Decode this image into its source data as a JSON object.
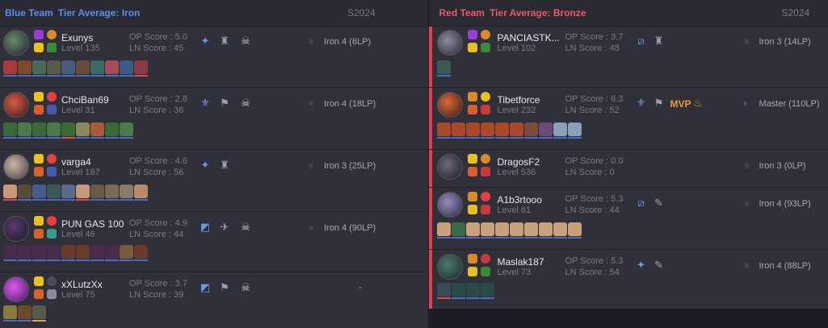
{
  "blue": {
    "team_name": "Blue Team",
    "tier_label": "Tier Average: Iron",
    "season": "S2024",
    "players": [
      {
        "name": "Exunys",
        "level": "Level 135",
        "op": "OP Score : 5.0",
        "ln": "LN Score : 45",
        "rank": "Iron 4 (6LP)"
      },
      {
        "name": "ChciBan69",
        "level": "Level 31",
        "op": "OP Score : 2.8",
        "ln": "LN Score : 36",
        "rank": "Iron 4 (18LP)"
      },
      {
        "name": "varga4",
        "level": "Level 187",
        "op": "OP Score : 4.6",
        "ln": "LN Score : 56",
        "rank": "Iron 3 (25LP)"
      },
      {
        "name": "PUN GAS 100",
        "level": "Level 46",
        "op": "OP Score : 4.9",
        "ln": "LN Score : 44",
        "rank": "Iron 4 (90LP)"
      },
      {
        "name": "xXLutzXx",
        "level": "Level 75",
        "op": "OP Score : 3.7",
        "ln": "LN Score : 39",
        "rank": "-"
      }
    ]
  },
  "red": {
    "team_name": "Red Team",
    "tier_label": "Tier Average: Bronze",
    "season": "S2024",
    "players": [
      {
        "name": "PANCIASTK...",
        "level": "Level 102",
        "op": "OP Score : 3.7",
        "ln": "LN Score : 48",
        "rank": "Iron 3 (14LP)"
      },
      {
        "name": "Tibetforce",
        "level": "Level 232",
        "op": "OP Score : 6.3",
        "ln": "LN Score : 52",
        "rank": "Master (110LP)",
        "badge": "MVP"
      },
      {
        "name": "DragosF2",
        "level": "Level 536",
        "op": "OP Score : 0.0",
        "ln": "LN Score : 0",
        "rank": "Iron 3 (0LP)"
      },
      {
        "name": "A1b3rtooo",
        "level": "Level 61",
        "op": "OP Score : 5.3",
        "ln": "LN Score : 44",
        "rank": "Iron 4 (93LP)"
      },
      {
        "name": "Maslak187",
        "level": "Level 73",
        "op": "OP Score : 5.3",
        "ln": "LN Score : 54",
        "rank": "Iron 4 (88LP)"
      }
    ]
  },
  "colors": {
    "blue_accent": "#5a8ef0",
    "red_accent": "#e85a6a",
    "panel": "#30303a",
    "mvp": "#e8a030"
  },
  "icons": [
    "summoner-spell-icon",
    "rune-icon",
    "role-icon",
    "skull-icon",
    "tier-emblem-icon",
    "champion-icon",
    "fire-icon"
  ]
}
